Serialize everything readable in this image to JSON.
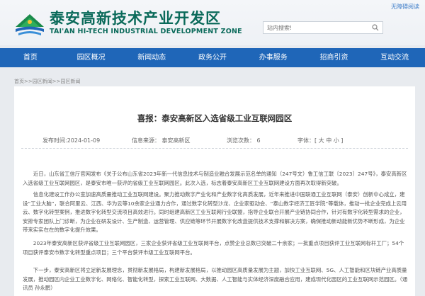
{
  "header": {
    "site_name_cn": "泰安高新技术产业开发区",
    "site_name_en": "TAI'AN HI-TECH INDUSTRIAL DEVELOPMENT ZONE",
    "top_link": "无障碍阅读",
    "search_placeholder": "站内搜索!"
  },
  "nav": {
    "items": [
      "首页",
      "园区概况",
      "新闻动态",
      "政务公开",
      "办事服务",
      "招商引资",
      "互动交流"
    ]
  },
  "breadcrumb": "首页>>园区新闻>>园区新闻",
  "article": {
    "title": "喜报：泰安高新区入选省级工业互联网园区",
    "meta": {
      "date": "发布时间:2024-01-09",
      "source": "信息来源：   泰安高新区",
      "views": "浏览次数：   6",
      "font": "字体：[ 大 中 小 ]"
    },
    "paragraphs": [
      "近日，山东省工信厅官网发布《关于公布山东省2023年新一代信息技术与制造业融合发展示范名单的通知（247号文）鲁工信工联〔2023〕247号》，泰安高新区入选省级工业互联网园区，是泰安市唯一获评的省级工业互联网园区。此次入选，标志着泰安高新区工业互联网建设方面再次取得新突破。",
      "信息化建设工作办公室加速高质量推动工业互联网建设。聚力推动数字产业化和产业数字化高质发展，近年来推进中国联通工业互联网（泰安）创新中心成立，建设“工业大脑”，联合阿里云、江西、华为云等10余家企业通力合作，通过数字化转型沙龙、企业家驱动会、“泰山数字经济工匠学院”等载体，推动一批企业完成上云用云、数字化转型案例，推进数字化转型交流项目高效进行。同时组建高新区工业互联网行业联盟，指导企业联合开展产业链协同合作，针对有数字化转型需求的企业，安排专家团队上门诊断，为企业在研发设计、生产制造、运营管理、供应链等环节开展数字化改造提供技术支撑和解决方案，确保推动新动能新优势不断形成，为企业带来实实在在的数字化提升效果。",
      "2023年泰安高新区获评省级工业互联网园区，三家企业获评省级工业互联网平台，点赞企业总数已突破二十余家；一批重点项目获评工业互联网标杆工厂；54个项目获评泰安市数字化转型重点项目；三个平台获评市级工业互联网平台。",
      "下一步，泰安高新区将立足新发展理念，贯彻新发展格局，构建新发展格局，以推动园区高质量发展为主题，加快工业互联网、5G、人工智能和区块链产业高质量发展，推动园区内企业工业数字化、网络化、智能化转型，探索工业互联网、大数据、人工智能与实体经济深度融合应用，建成现代化园区的工业互联网示范园区。（通讯员 孙永鹏）"
    ]
  }
}
